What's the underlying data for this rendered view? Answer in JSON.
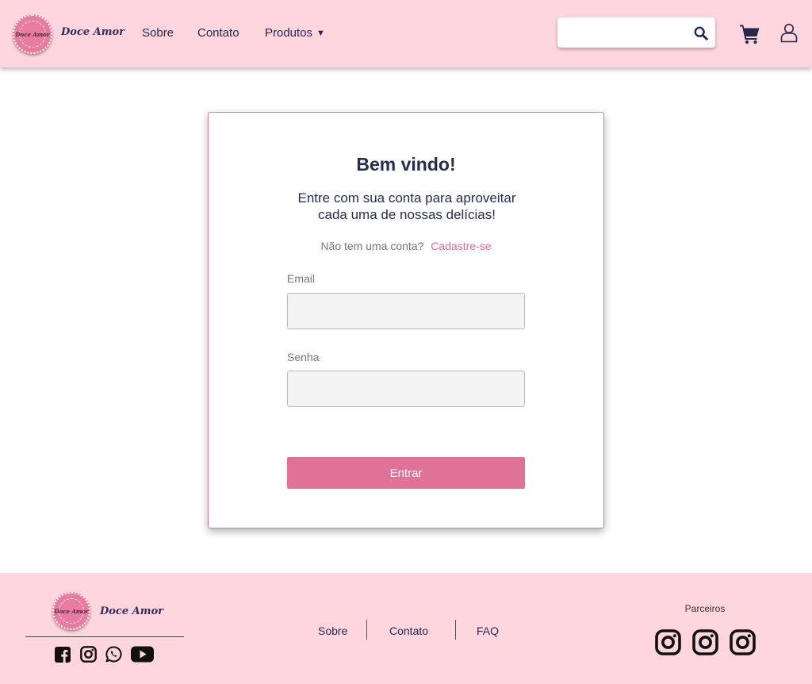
{
  "brand": {
    "name": "Doce Amor",
    "badge_text": "Doce Amor",
    "colors": {
      "header_bg": "#ffd6de",
      "accent": "#e07298",
      "navy": "#252c50"
    }
  },
  "nav": {
    "items": [
      "Sobre",
      "Contato",
      "Produtos"
    ]
  },
  "header": {
    "search": {
      "placeholder": "",
      "icon": "search-icon"
    },
    "cart_icon": "cart-icon",
    "user_icon": "user-icon"
  },
  "login": {
    "title": "Bem vindo!",
    "subtitle": "Entre com sua conta para aproveitar cada uma de nossas delícias!",
    "no_account": "Não tem uma conta?",
    "signup_link": "Cadastre-se",
    "email_label": "Email",
    "email_value": "",
    "password_label": "Senha",
    "password_value": "",
    "submit_label": "Entrar"
  },
  "footer": {
    "brand": "Doce Amor",
    "social_icons": [
      "facebook-icon",
      "instagram-icon",
      "whatsapp-icon",
      "youtube-icon"
    ],
    "links": [
      "Sobre",
      "Contato",
      "FAQ"
    ],
    "partners_title": "Parceiros",
    "partner_icons": [
      "instagram-icon",
      "instagram-icon",
      "instagram-icon"
    ]
  }
}
